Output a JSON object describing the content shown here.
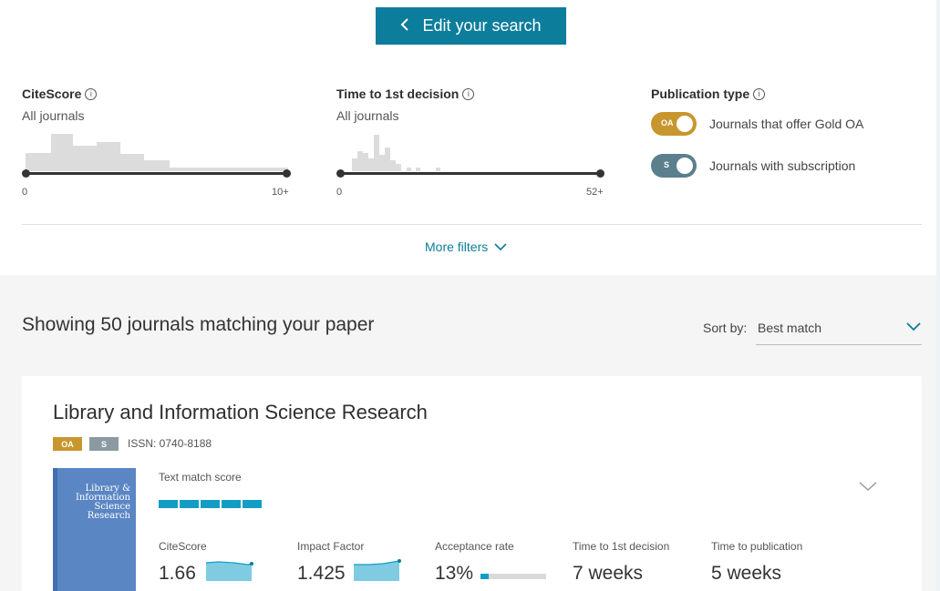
{
  "edit_search": {
    "label": "Edit your search",
    "icon": "chevron-left-icon"
  },
  "filters": {
    "citescore": {
      "title": "CiteScore",
      "sub": "All journals",
      "min_label": "0",
      "max_label": "10+"
    },
    "time_decision": {
      "title": "Time to 1st decision",
      "sub": "All journals",
      "min_label": "0",
      "max_label": "52+"
    },
    "publication_type": {
      "title": "Publication type",
      "gold_oa": {
        "badge": "OA",
        "label": "Journals that offer Gold OA",
        "color": "#c8962e",
        "on": true
      },
      "subscription": {
        "badge": "S",
        "label": "Journals with subscription",
        "color": "#5b7f8c",
        "on": true
      }
    },
    "more_filters": "More filters"
  },
  "results": {
    "showing": "Showing 50 journals matching your paper",
    "sort_label": "Sort by:",
    "sort_value": "Best match"
  },
  "journal": {
    "title": "Library and Information Science Research",
    "badge_oa": "OA",
    "badge_s": "S",
    "issn": "ISSN: 0740-8188",
    "cover_text": "Library & Information Science Research",
    "text_match_label": "Text match score",
    "text_match_segments": 5,
    "metrics": {
      "citescore": {
        "label": "CiteScore",
        "value": "1.66"
      },
      "impact_factor": {
        "label": "Impact Factor",
        "value": "1.425"
      },
      "acceptance": {
        "label": "Acceptance rate",
        "value": "13%",
        "fraction": 0.13
      },
      "time_decision": {
        "label": "Time to 1st decision",
        "value": "7 weeks"
      },
      "time_publication": {
        "label": "Time to publication",
        "value": "5 weeks"
      }
    }
  },
  "colors": {
    "accent": "#0c7d9b",
    "bar_blue": "#149dc4",
    "oa_gold": "#c8962e",
    "sub_gray": "#5b7f8c"
  }
}
